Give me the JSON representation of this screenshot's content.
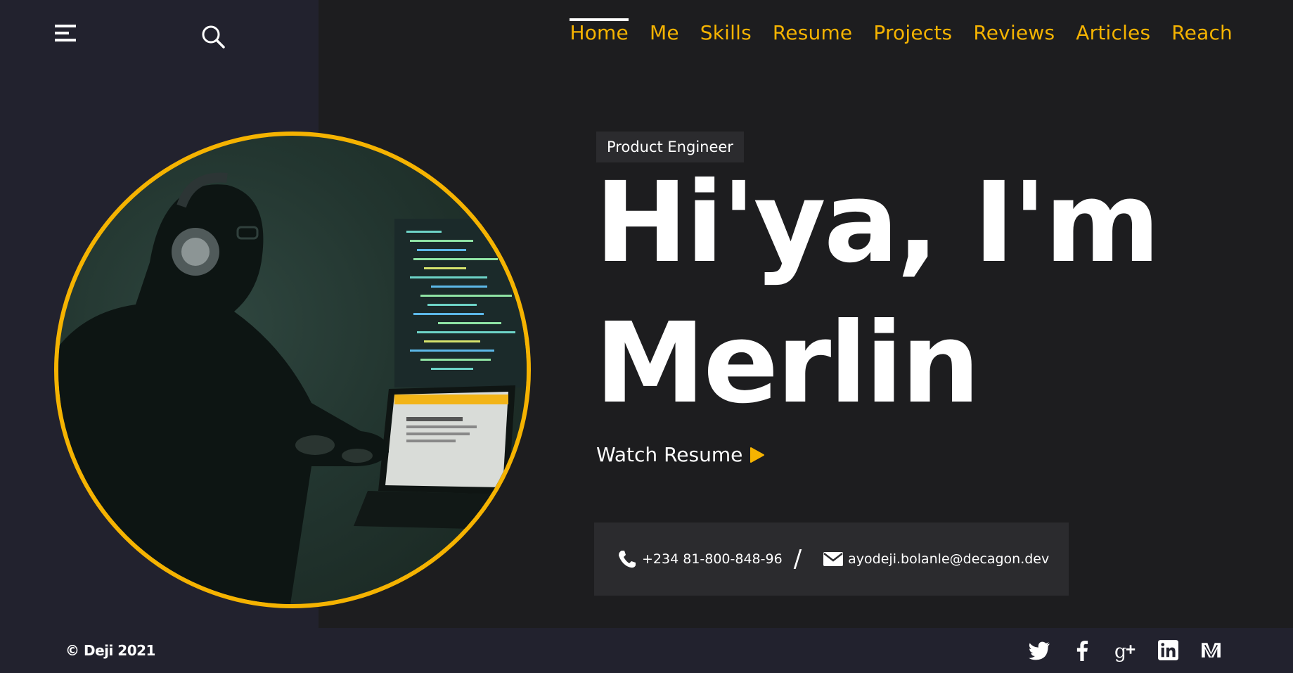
{
  "header": {
    "menu_icon": "hamburger-menu-icon",
    "search_icon": "search-icon"
  },
  "nav": {
    "items": [
      {
        "label": "Home",
        "active": true
      },
      {
        "label": "Me"
      },
      {
        "label": "Skills"
      },
      {
        "label": "Resume"
      },
      {
        "label": "Projects"
      },
      {
        "label": "Reviews"
      },
      {
        "label": "Articles"
      },
      {
        "label": "Reach"
      }
    ]
  },
  "hero": {
    "role": "Product Engineer",
    "line1": "Hi'ya, I'm",
    "line2": "Merlin",
    "watch_label": "Watch Resume",
    "watch_icon": "play-icon"
  },
  "contact": {
    "phone": "+234 81-800-848-96",
    "separator": "/",
    "email": "ayodeji.bolanle@decagon.dev",
    "phone_icon": "phone-icon",
    "email_icon": "envelope-icon"
  },
  "footer": {
    "copyright": "© Deji 2021",
    "socials": [
      "twitter-icon",
      "facebook-icon",
      "google-plus-icon",
      "linkedin-icon",
      "medium-icon"
    ]
  },
  "colors": {
    "accent": "#f5b301",
    "side_panel": "#22222e",
    "background": "#1d1d1f",
    "box": "#2b2b2e",
    "text": "#ffffff"
  }
}
